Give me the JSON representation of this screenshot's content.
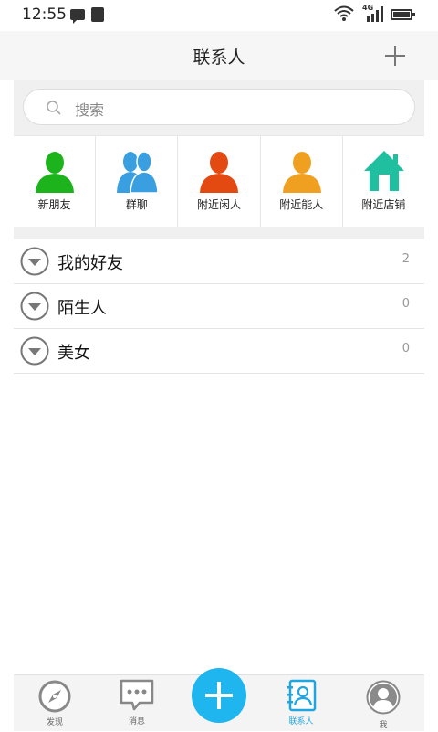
{
  "status": {
    "time": "12:55",
    "network": "4G"
  },
  "header": {
    "title": "联系人"
  },
  "search": {
    "placeholder": "搜索"
  },
  "shortcuts": [
    {
      "label": "新朋友",
      "icon": "person-icon",
      "color": "#1db31d"
    },
    {
      "label": "群聊",
      "icon": "group-icon",
      "color": "#3a9fe0"
    },
    {
      "label": "附近闲人",
      "icon": "person-icon",
      "color": "#e24a12"
    },
    {
      "label": "附近能人",
      "icon": "person-icon",
      "color": "#f0a020"
    },
    {
      "label": "附近店铺",
      "icon": "house-icon",
      "color": "#1fbf9f"
    }
  ],
  "groups": [
    {
      "name": "我的好友",
      "count": "2"
    },
    {
      "name": "陌生人",
      "count": "0"
    },
    {
      "name": "美女",
      "count": "0"
    }
  ],
  "tabs": [
    {
      "label": "发现",
      "icon": "compass-icon"
    },
    {
      "label": "消息",
      "icon": "chat-icon"
    },
    {
      "label": "联系人",
      "icon": "contacts-icon",
      "active": true
    },
    {
      "label": "我",
      "icon": "avatar-icon"
    }
  ],
  "colors": {
    "accent": "#1fb6f0",
    "active_tab": "#1fa6e0"
  }
}
